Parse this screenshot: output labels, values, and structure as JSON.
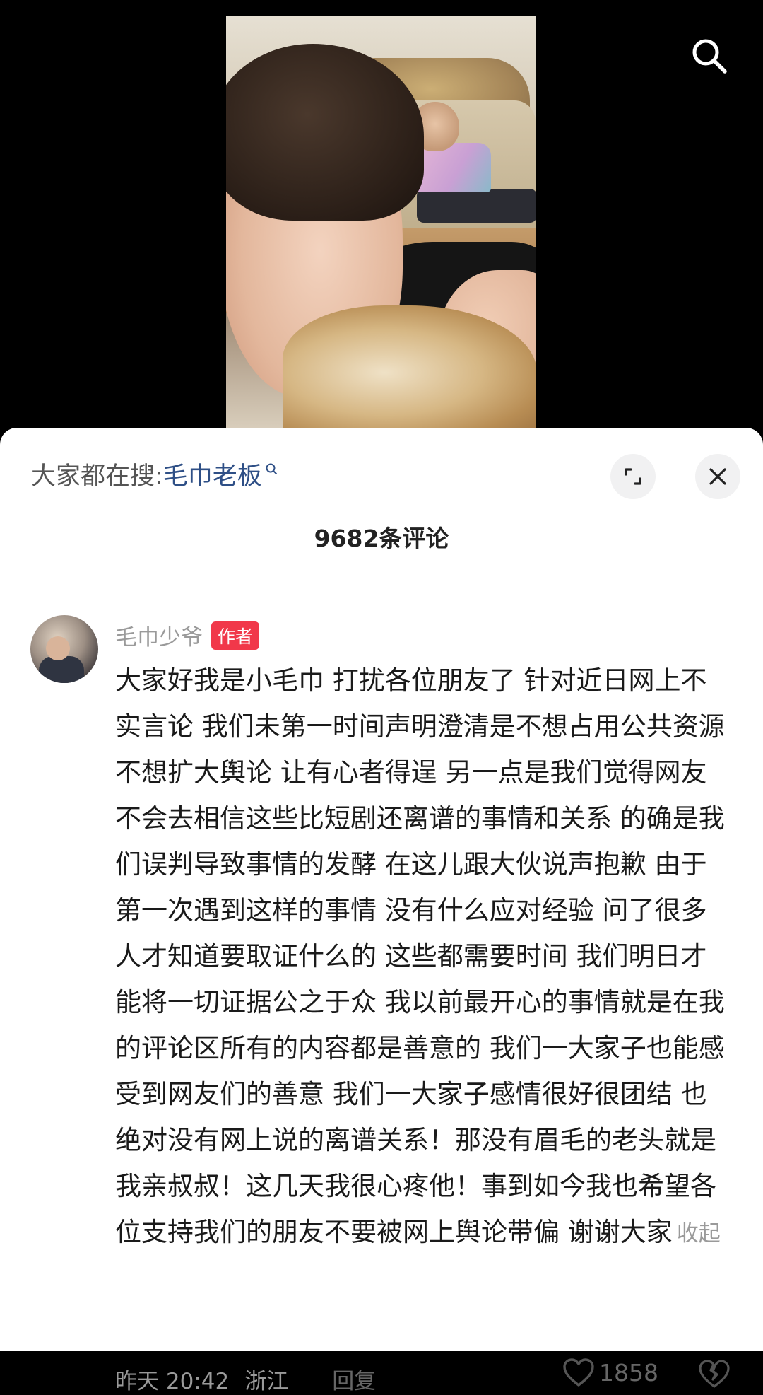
{
  "search_bar": {
    "prefix": "大家都在搜:",
    "term": "毛巾老板"
  },
  "header": {
    "comment_count": "9682条评论"
  },
  "comment": {
    "author": "毛巾少爷",
    "badge": "作者",
    "text": "大家好我是小毛巾 打扰各位朋友了 针对近日网上不实言论 我们未第一时间声明澄清是不想占用公共资源 不想扩大舆论 让有心者得逞 另一点是我们觉得网友不会去相信这些比短剧还离谱的事情和关系 的确是我们误判导致事情的发酵 在这儿跟大伙说声抱歉  由于第一次遇到这样的事情 没有什么应对经验 问了很多人才知道要取证什么的 这些都需要时间 我们明日才能将一切证据公之于众 我以前最开心的事情就是在我的评论区所有的内容都是善意的 我们一大家子也能感受到网友们的善意 我们一大家子感情很好很团结 也绝对没有网上说的离谱关系！那没有眉毛的老头就是我亲叔叔！这几天我很心疼他！事到如今我也希望各位支持我们的朋友不要被网上舆论带偏 谢谢大家",
    "collapse_label": "收起",
    "time": "昨天 20:42",
    "location": "浙江",
    "reply_label": "回复",
    "like_count": "1858"
  },
  "icons": {
    "video_search": "search-icon",
    "expand": "expand-icon",
    "close": "close-icon",
    "like": "heart-icon",
    "dislike": "broken-heart-icon"
  },
  "colors": {
    "search_term": "#2e4f86",
    "badge_bg": "#f1384a",
    "muted_text": "#9a9a9a"
  }
}
